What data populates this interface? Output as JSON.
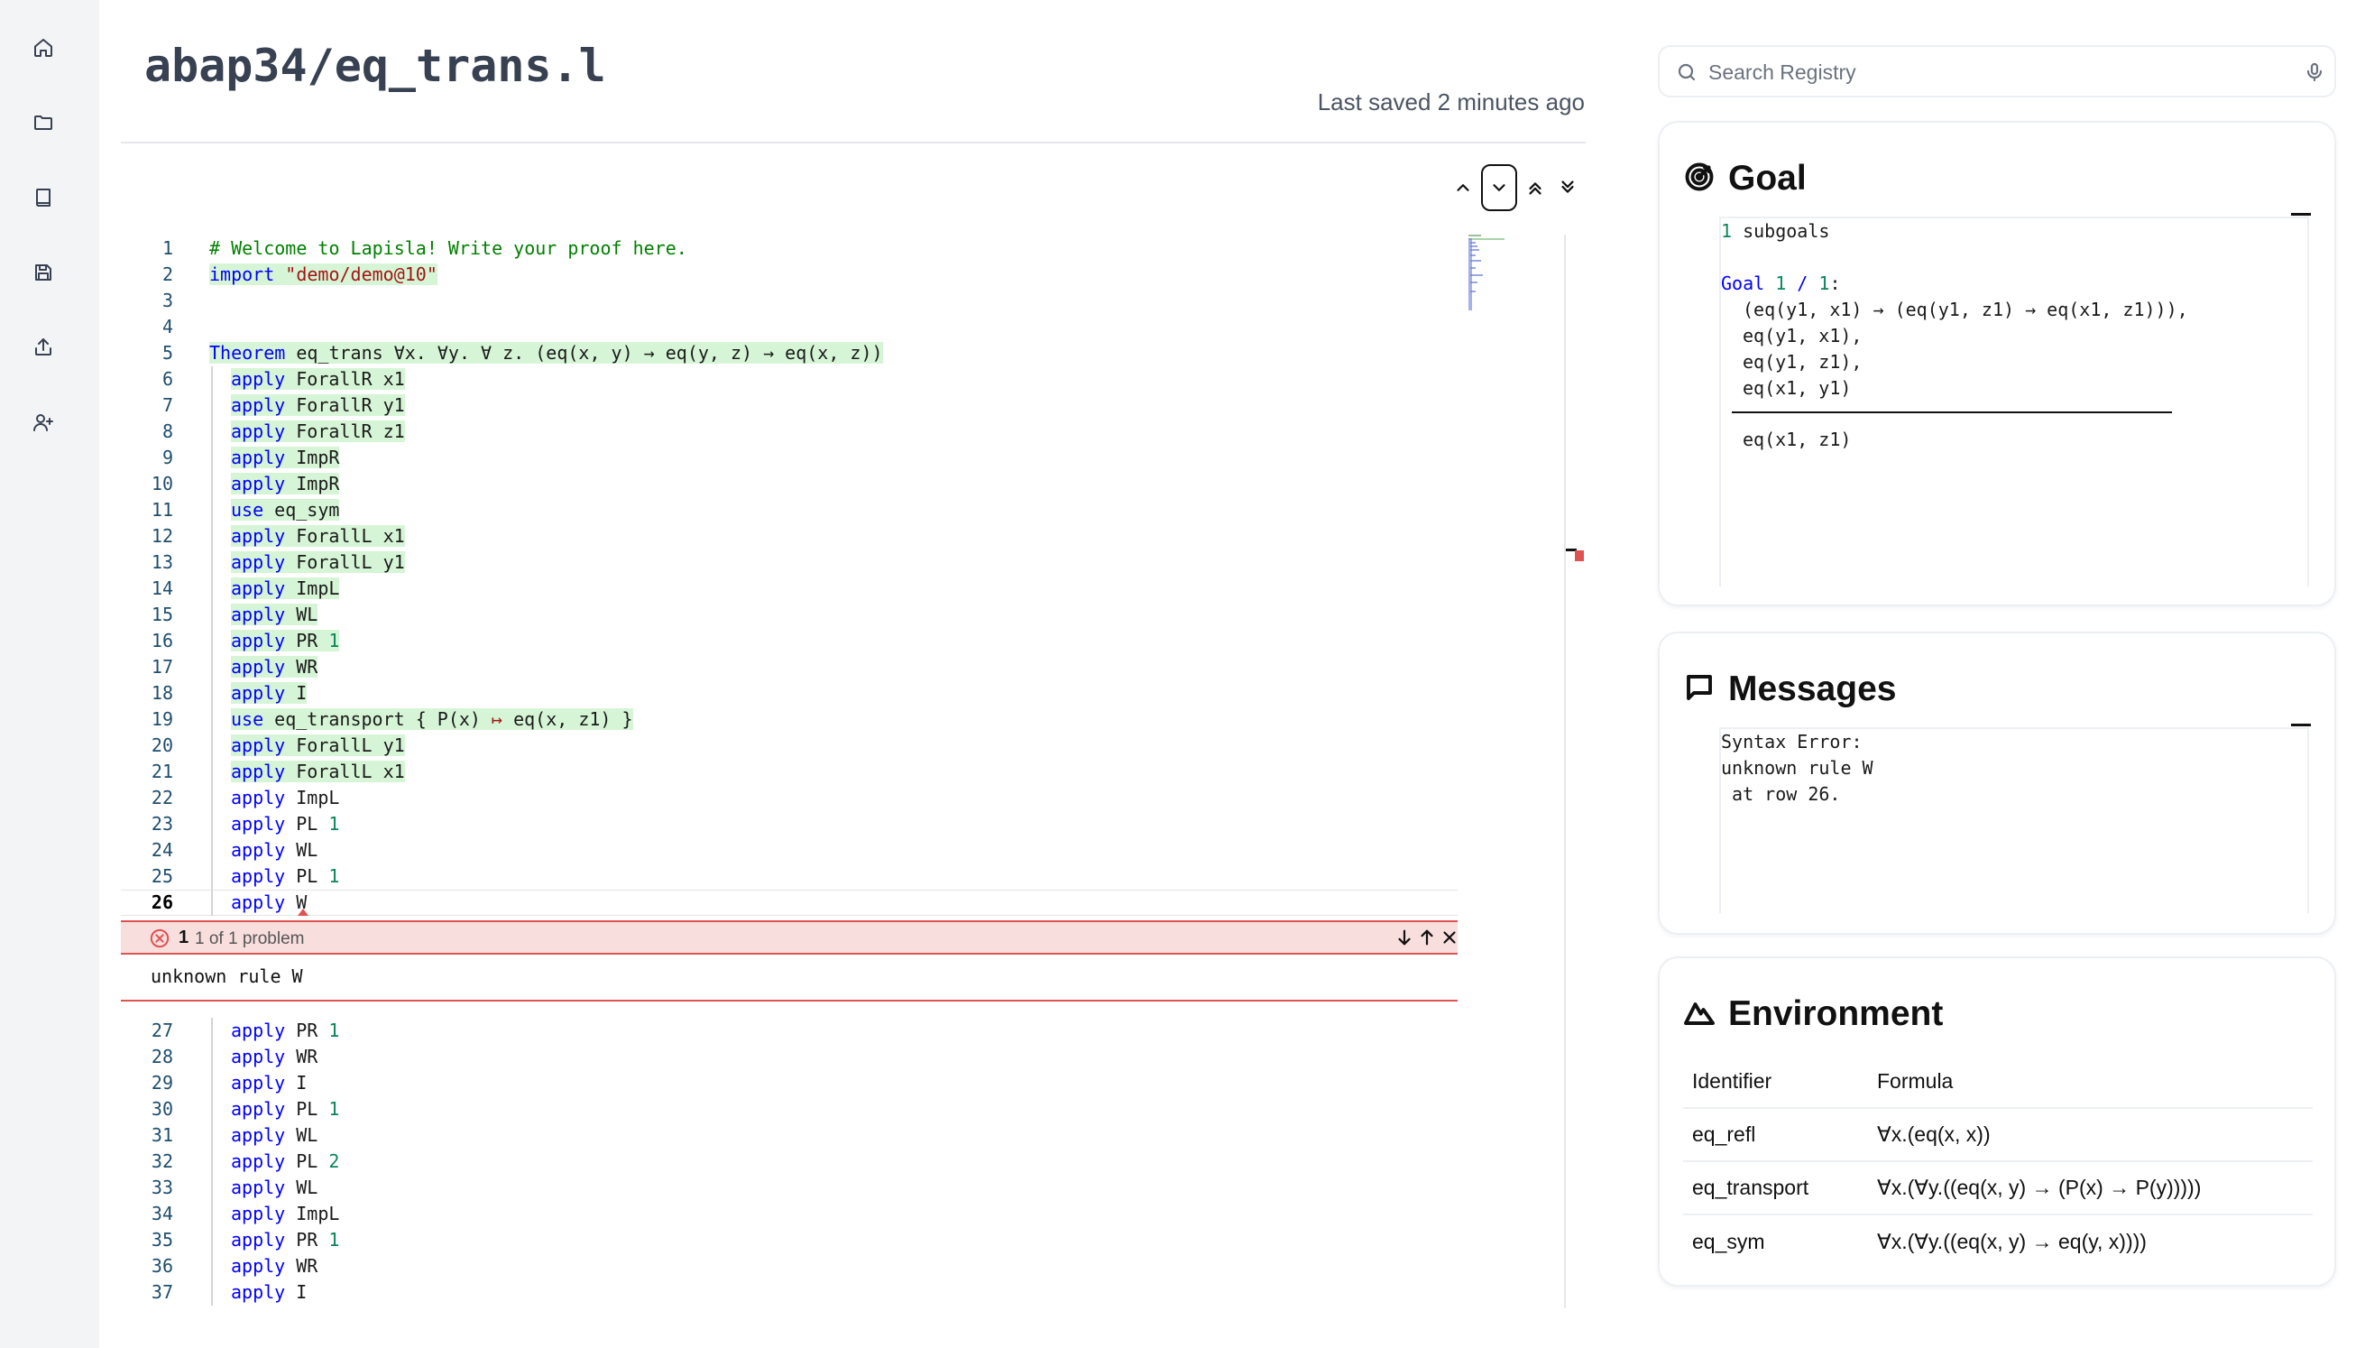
{
  "sidebar": {
    "items": [
      {
        "name": "home",
        "icon": "home-icon"
      },
      {
        "name": "folder",
        "icon": "folder-icon"
      },
      {
        "name": "book",
        "icon": "book-icon"
      },
      {
        "name": "save",
        "icon": "save-icon"
      },
      {
        "name": "share",
        "icon": "share-icon"
      },
      {
        "name": "add-user",
        "icon": "user-plus-icon"
      }
    ]
  },
  "header": {
    "file_title": "abap34/eq_trans.l",
    "last_saved": "Last saved 2 minutes ago"
  },
  "editor": {
    "toolbar": [
      "chevron-up-icon",
      "chevron-down-icon",
      "chevrons-up-icon",
      "chevrons-down-icon"
    ],
    "lines_before": [
      {
        "n": "1",
        "segs": [
          {
            "t": "# Welcome to Lapisla! Write your proof here.",
            "c": "com"
          }
        ]
      },
      {
        "n": "2",
        "hl": true,
        "segs": [
          {
            "t": "import",
            "c": "kw"
          },
          {
            "t": " "
          },
          {
            "t": "\"demo/demo@10\"",
            "c": "str"
          }
        ]
      },
      {
        "n": "3",
        "segs": []
      },
      {
        "n": "4",
        "segs": []
      },
      {
        "n": "5",
        "hl": true,
        "segs": [
          {
            "t": "Theorem",
            "c": "kw"
          },
          {
            "t": " eq_trans ∀x. ∀y. ∀ z. (eq(x, y) → eq(y, z) → eq(x, z))"
          }
        ]
      },
      {
        "n": "6",
        "hl": true,
        "indent": true,
        "segs": [
          {
            "t": "apply",
            "c": "kw"
          },
          {
            "t": " ForallR x1"
          }
        ]
      },
      {
        "n": "7",
        "hl": true,
        "indent": true,
        "segs": [
          {
            "t": "apply",
            "c": "kw"
          },
          {
            "t": " ForallR y1"
          }
        ]
      },
      {
        "n": "8",
        "hl": true,
        "indent": true,
        "segs": [
          {
            "t": "apply",
            "c": "kw"
          },
          {
            "t": " ForallR z1"
          }
        ]
      },
      {
        "n": "9",
        "hl": true,
        "indent": true,
        "segs": [
          {
            "t": "apply",
            "c": "kw"
          },
          {
            "t": " ImpR"
          }
        ]
      },
      {
        "n": "10",
        "hl": true,
        "indent": true,
        "segs": [
          {
            "t": "apply",
            "c": "kw"
          },
          {
            "t": " ImpR"
          }
        ]
      },
      {
        "n": "11",
        "hl": true,
        "indent": true,
        "segs": [
          {
            "t": "use",
            "c": "kw"
          },
          {
            "t": " eq_sym"
          }
        ]
      },
      {
        "n": "12",
        "hl": true,
        "indent": true,
        "segs": [
          {
            "t": "apply",
            "c": "kw"
          },
          {
            "t": " ForallL x1"
          }
        ]
      },
      {
        "n": "13",
        "hl": true,
        "indent": true,
        "segs": [
          {
            "t": "apply",
            "c": "kw"
          },
          {
            "t": " ForallL y1"
          }
        ]
      },
      {
        "n": "14",
        "hl": true,
        "indent": true,
        "segs": [
          {
            "t": "apply",
            "c": "kw"
          },
          {
            "t": " ImpL"
          }
        ]
      },
      {
        "n": "15",
        "hl": true,
        "indent": true,
        "segs": [
          {
            "t": "apply",
            "c": "kw"
          },
          {
            "t": " WL"
          }
        ]
      },
      {
        "n": "16",
        "hl": true,
        "indent": true,
        "segs": [
          {
            "t": "apply",
            "c": "kw"
          },
          {
            "t": " PR "
          },
          {
            "t": "1",
            "c": "num"
          }
        ]
      },
      {
        "n": "17",
        "hl": true,
        "indent": true,
        "segs": [
          {
            "t": "apply",
            "c": "kw"
          },
          {
            "t": " WR"
          }
        ]
      },
      {
        "n": "18",
        "hl": true,
        "indent": true,
        "segs": [
          {
            "t": "apply",
            "c": "kw"
          },
          {
            "t": " I"
          }
        ]
      },
      {
        "n": "19",
        "hl": true,
        "indent": true,
        "segs": [
          {
            "t": "use",
            "c": "kw"
          },
          {
            "t": " eq_transport { P(x) "
          },
          {
            "t": "↦",
            "c": "str"
          },
          {
            "t": " eq(x, z1) }"
          }
        ]
      },
      {
        "n": "20",
        "hl": true,
        "indent": true,
        "segs": [
          {
            "t": "apply",
            "c": "kw"
          },
          {
            "t": " ForallL y1"
          }
        ]
      },
      {
        "n": "21",
        "hl": true,
        "indent": true,
        "segs": [
          {
            "t": "apply",
            "c": "kw"
          },
          {
            "t": " ForallL x1"
          }
        ]
      },
      {
        "n": "22",
        "indent": true,
        "segs": [
          {
            "t": "apply",
            "c": "kw"
          },
          {
            "t": " ImpL"
          }
        ]
      },
      {
        "n": "23",
        "indent": true,
        "segs": [
          {
            "t": "apply",
            "c": "kw"
          },
          {
            "t": " PL "
          },
          {
            "t": "1",
            "c": "num"
          }
        ]
      },
      {
        "n": "24",
        "indent": true,
        "segs": [
          {
            "t": "apply",
            "c": "kw"
          },
          {
            "t": " WL"
          }
        ]
      },
      {
        "n": "25",
        "indent": true,
        "segs": [
          {
            "t": "apply",
            "c": "kw"
          },
          {
            "t": " PL "
          },
          {
            "t": "1",
            "c": "num"
          }
        ]
      },
      {
        "n": "26",
        "cur": true,
        "indent": true,
        "segs": [
          {
            "t": "apply",
            "c": "kw"
          },
          {
            "t": " W"
          }
        ]
      }
    ],
    "problem": {
      "count": "1",
      "summary": "1 of 1 problem",
      "message": "unknown rule W"
    },
    "lines_after": [
      {
        "n": "27",
        "indent": true,
        "segs": [
          {
            "t": "apply",
            "c": "kw"
          },
          {
            "t": " PR "
          },
          {
            "t": "1",
            "c": "num"
          }
        ]
      },
      {
        "n": "28",
        "indent": true,
        "segs": [
          {
            "t": "apply",
            "c": "kw"
          },
          {
            "t": " WR"
          }
        ]
      },
      {
        "n": "29",
        "indent": true,
        "segs": [
          {
            "t": "apply",
            "c": "kw"
          },
          {
            "t": " I"
          }
        ]
      },
      {
        "n": "30",
        "indent": true,
        "segs": [
          {
            "t": "apply",
            "c": "kw"
          },
          {
            "t": " PL "
          },
          {
            "t": "1",
            "c": "num"
          }
        ]
      },
      {
        "n": "31",
        "indent": true,
        "segs": [
          {
            "t": "apply",
            "c": "kw"
          },
          {
            "t": " WL"
          }
        ]
      },
      {
        "n": "32",
        "indent": true,
        "segs": [
          {
            "t": "apply",
            "c": "kw"
          },
          {
            "t": " PL "
          },
          {
            "t": "2",
            "c": "num"
          }
        ]
      },
      {
        "n": "33",
        "indent": true,
        "segs": [
          {
            "t": "apply",
            "c": "kw"
          },
          {
            "t": " WL"
          }
        ]
      },
      {
        "n": "34",
        "indent": true,
        "segs": [
          {
            "t": "apply",
            "c": "kw"
          },
          {
            "t": " ImpL"
          }
        ]
      },
      {
        "n": "35",
        "indent": true,
        "segs": [
          {
            "t": "apply",
            "c": "kw"
          },
          {
            "t": " PR "
          },
          {
            "t": "1",
            "c": "num"
          }
        ]
      },
      {
        "n": "36",
        "indent": true,
        "segs": [
          {
            "t": "apply",
            "c": "kw"
          },
          {
            "t": " WR"
          }
        ]
      },
      {
        "n": "37",
        "indent": true,
        "segs": [
          {
            "t": "apply",
            "c": "kw"
          },
          {
            "t": " I"
          }
        ]
      }
    ]
  },
  "search": {
    "placeholder": "Search Registry"
  },
  "goal": {
    "title": "Goal",
    "subgoals_num": "1",
    "subgoals_label": " subgoals",
    "goal_kw": "Goal",
    "goal_index": "1",
    "goal_sep": " / ",
    "goal_total": "1",
    "goal_colon": ":",
    "hypotheses": [
      "(eq(y1, x1) → (eq(y1, z1) → eq(x1, z1))),",
      "eq(y1, x1),",
      "eq(y1, z1),",
      "eq(x1, y1)"
    ],
    "conclusion": "eq(x1, z1)"
  },
  "messages": {
    "title": "Messages",
    "lines": [
      "Syntax Error:",
      "unknown rule W",
      " at row 26."
    ]
  },
  "environment": {
    "title": "Environment",
    "columns": [
      "Identifier",
      "Formula"
    ],
    "rows": [
      {
        "id": "eq_refl",
        "formula": "∀x.(eq(x, x))"
      },
      {
        "id": "eq_transport",
        "formula": "∀x.(∀y.((eq(x, y) → (P(x) → P(y)))))"
      },
      {
        "id": "eq_sym",
        "formula": "∀x.(∀y.((eq(x, y) → eq(y, x))))"
      }
    ]
  },
  "colors": {
    "keyword": "#0000ff",
    "string": "#a31515",
    "comment": "#008000",
    "number": "#098658",
    "highlight": "#d6f5d6",
    "error": "#e05252"
  }
}
